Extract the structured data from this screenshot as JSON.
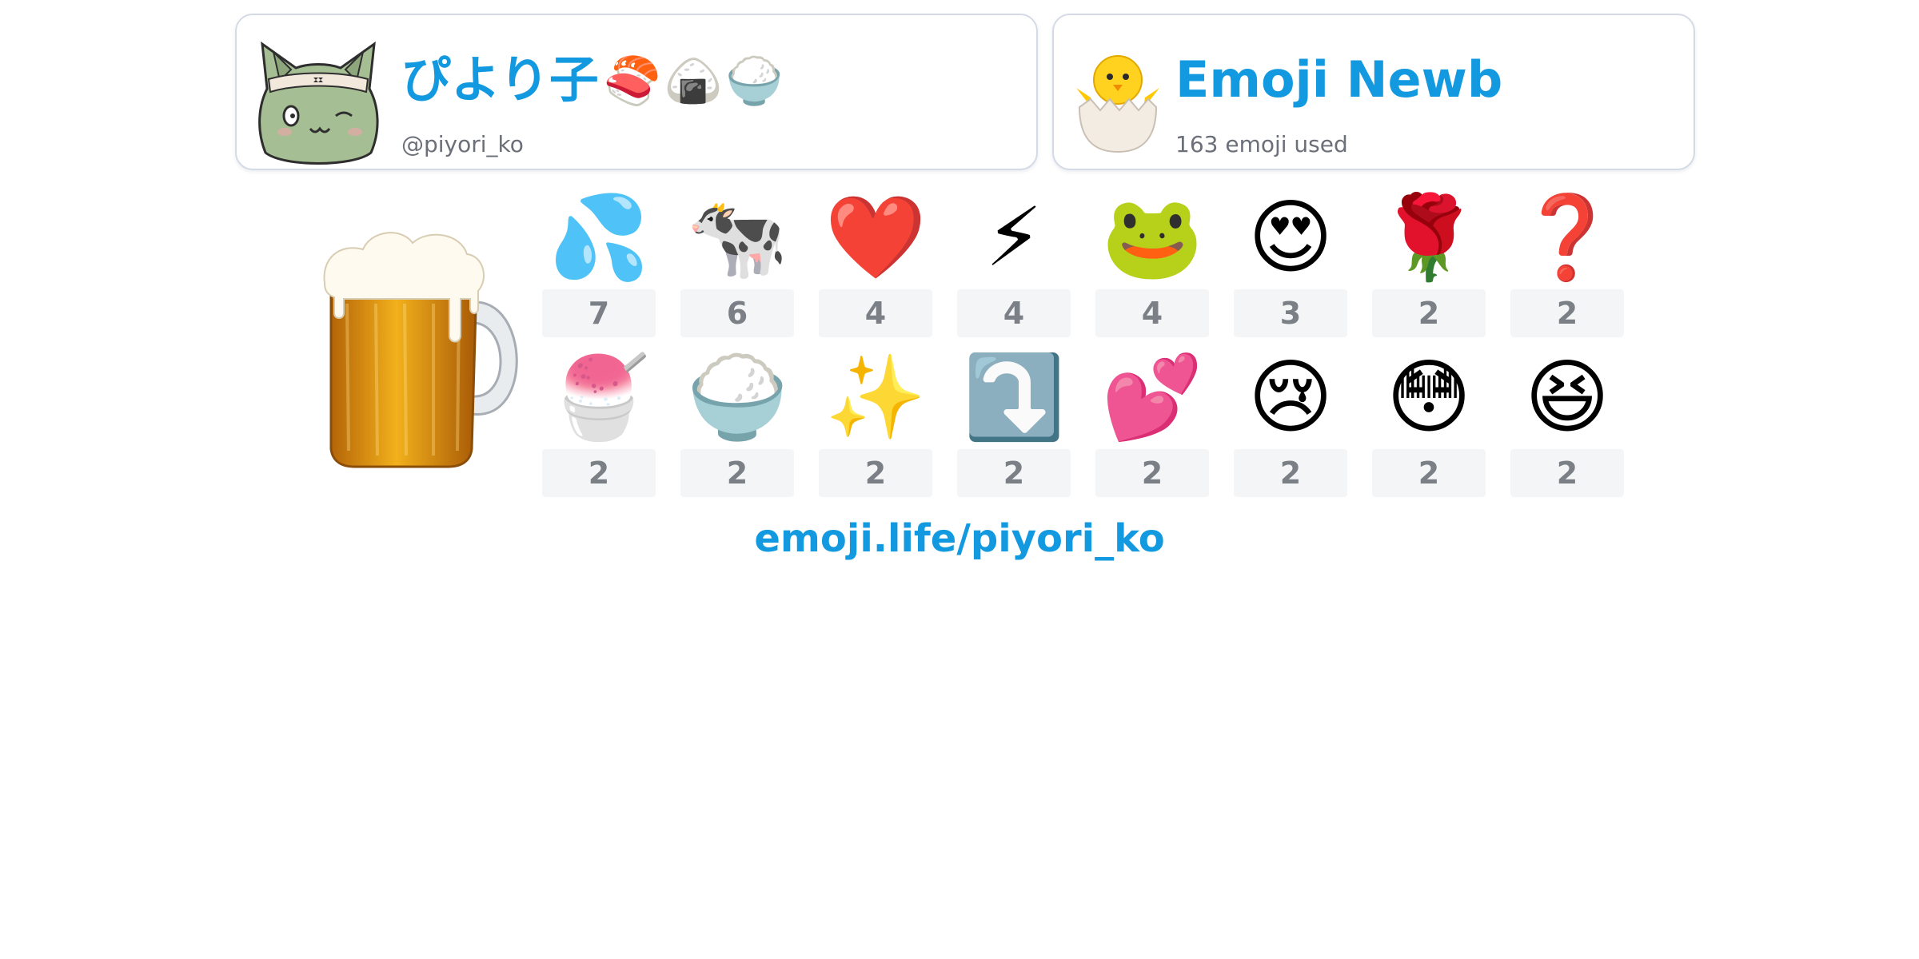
{
  "profile": {
    "display_name": "ぴより子",
    "name_emoji": "🍣🍙🍚",
    "handle": "@piyori_ko",
    "avatar_icon": "cat-headband-avatar-icon"
  },
  "rank": {
    "title": "Emoji Newb",
    "subtitle": "163 emoji used",
    "badge_icon": "hatching-chick-icon"
  },
  "top_emoji": {
    "emoji": "🍺",
    "icon": "beer-mug-icon"
  },
  "emoji_counts": [
    {
      "emoji": "💦",
      "count": "7"
    },
    {
      "emoji": "🐄",
      "count": "6"
    },
    {
      "emoji": "❤️",
      "count": "4"
    },
    {
      "emoji": "⚡",
      "count": "4"
    },
    {
      "emoji": "🐸",
      "count": "4"
    },
    {
      "emoji": "😍",
      "count": "3"
    },
    {
      "emoji": "🌹",
      "count": "2"
    },
    {
      "emoji": "❓",
      "count": "2"
    },
    {
      "emoji": "🍧",
      "count": "2"
    },
    {
      "emoji": "🍚",
      "count": "2"
    },
    {
      "emoji": "✨",
      "count": "2"
    },
    {
      "emoji": "⤵️",
      "count": "2"
    },
    {
      "emoji": "💕",
      "count": "2"
    },
    {
      "emoji": "😢",
      "count": "2"
    },
    {
      "emoji": "😳",
      "count": "2"
    },
    {
      "emoji": "😆",
      "count": "2"
    }
  ],
  "footer": {
    "link": "emoji.life/piyori_ko"
  },
  "colors": {
    "accent": "#1399e0",
    "count_bg": "#f4f5f7",
    "count_text": "#7b7f86",
    "card_border": "#d4dae6",
    "muted_text": "#6b6f78"
  }
}
